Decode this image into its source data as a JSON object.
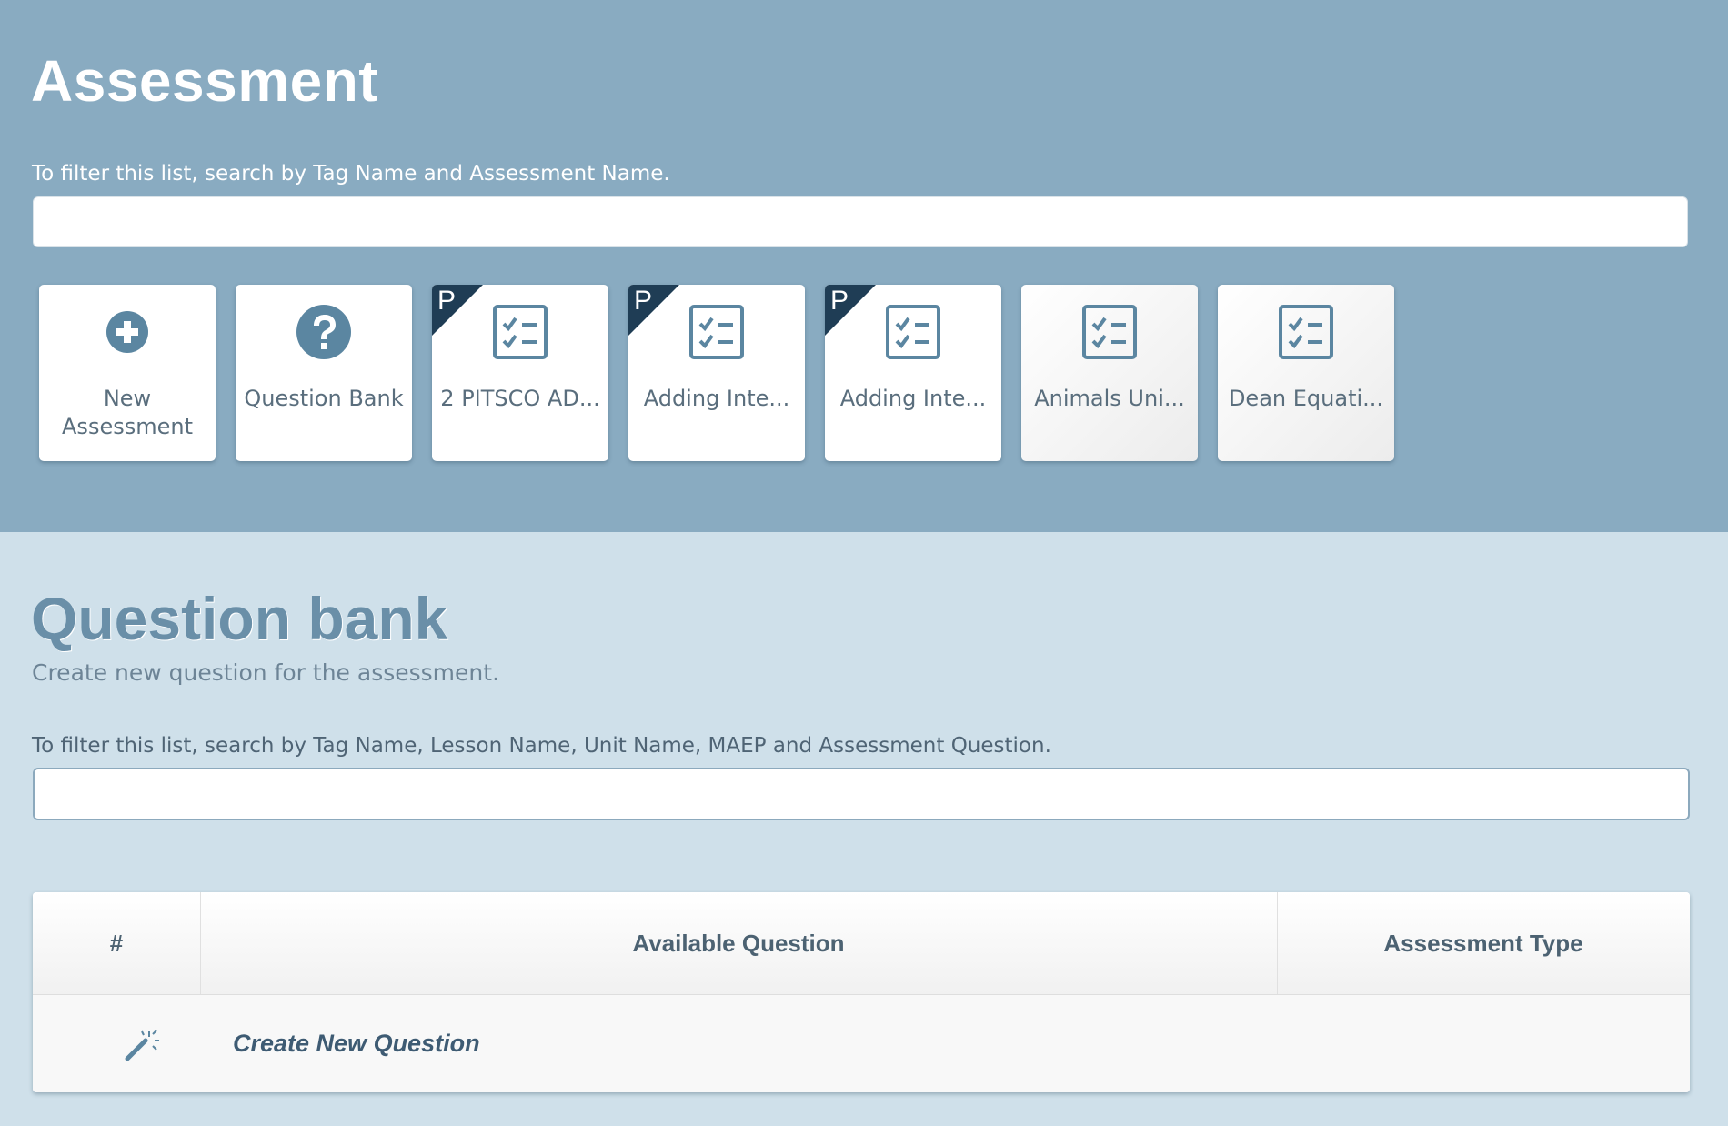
{
  "assessment": {
    "title": "Assessment",
    "filter_hint": "To filter this list, search by Tag Name and Assessment Name.",
    "search_value": "",
    "tiles": [
      {
        "label": "New Assessment",
        "icon": "plus-circle-icon",
        "ribbon": ""
      },
      {
        "label": "Question Bank",
        "icon": "question-circle-icon",
        "ribbon": ""
      },
      {
        "label": "2 PITSCO AD...",
        "icon": "checklist-icon",
        "ribbon": "P"
      },
      {
        "label": "Adding Inte...",
        "icon": "checklist-icon",
        "ribbon": "P"
      },
      {
        "label": "Adding Inte...",
        "icon": "checklist-icon",
        "ribbon": "P"
      },
      {
        "label": "Animals Uni...",
        "icon": "checklist-icon",
        "ribbon": ""
      },
      {
        "label": "Dean Equati...",
        "icon": "checklist-icon",
        "ribbon": ""
      }
    ]
  },
  "question_bank": {
    "title": "Question bank",
    "subtitle": "Create new question for the assessment.",
    "filter_hint": "To filter this list, search by Tag Name, Lesson Name, Unit Name, MAEP and Assessment Question.",
    "search_value": "",
    "table": {
      "headers": [
        "#",
        "Available Question",
        "Assessment Type"
      ],
      "create_row": {
        "icon": "magic-wand-icon",
        "label": "Create New Question"
      }
    }
  },
  "colors": {
    "top_bg": "#89abc1",
    "bottom_bg": "#cfe0ea",
    "icon": "#5b86a1",
    "ribbon": "#1f3d55"
  }
}
